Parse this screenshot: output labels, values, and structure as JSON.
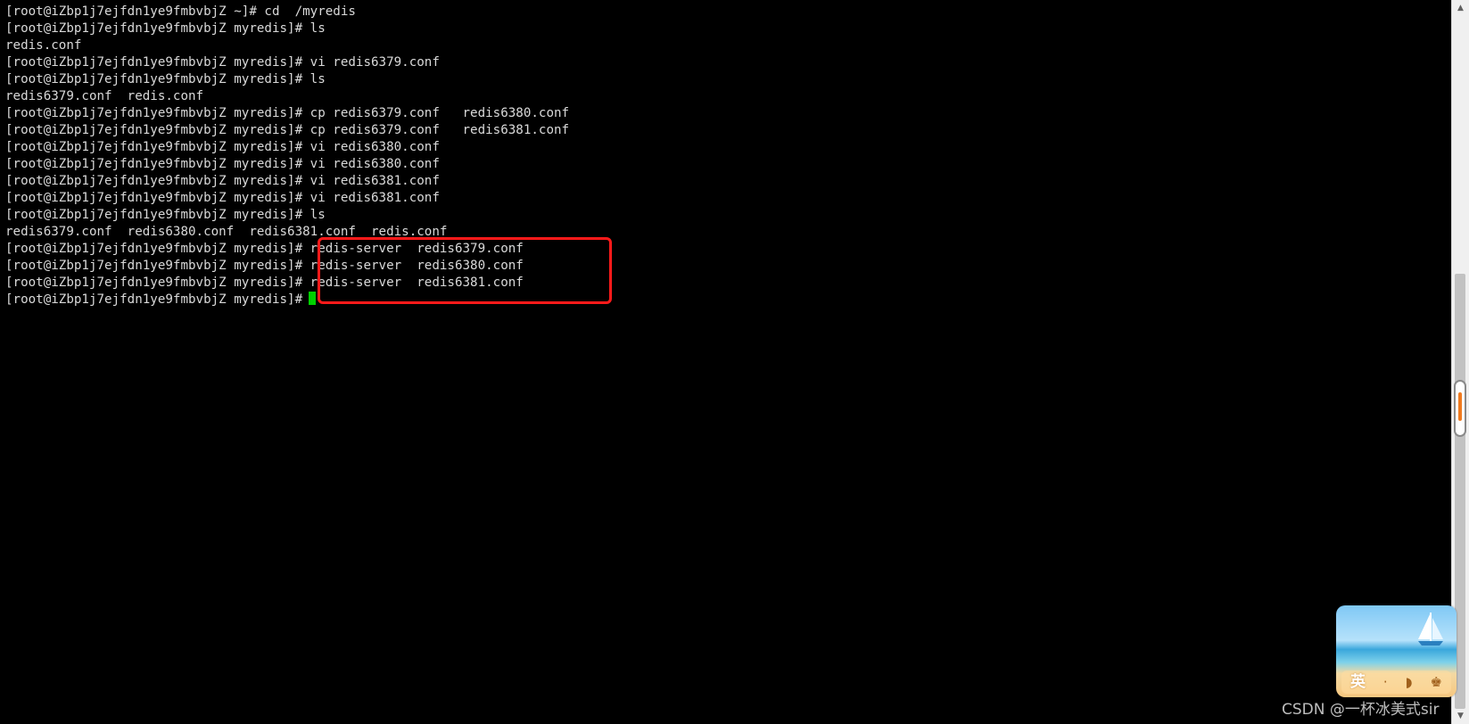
{
  "terminal": {
    "lines": [
      "[root@iZbp1j7ejfdn1ye9fmbvbjZ ~]# cd  /myredis",
      "[root@iZbp1j7ejfdn1ye9fmbvbjZ myredis]# ls",
      "redis.conf",
      "[root@iZbp1j7ejfdn1ye9fmbvbjZ myredis]# vi redis6379.conf",
      "[root@iZbp1j7ejfdn1ye9fmbvbjZ myredis]# ls",
      "redis6379.conf  redis.conf",
      "[root@iZbp1j7ejfdn1ye9fmbvbjZ myredis]# cp redis6379.conf   redis6380.conf",
      "[root@iZbp1j7ejfdn1ye9fmbvbjZ myredis]# cp redis6379.conf   redis6381.conf",
      "[root@iZbp1j7ejfdn1ye9fmbvbjZ myredis]# vi redis6380.conf",
      "[root@iZbp1j7ejfdn1ye9fmbvbjZ myredis]# vi redis6380.conf",
      "[root@iZbp1j7ejfdn1ye9fmbvbjZ myredis]# vi redis6381.conf",
      "[root@iZbp1j7ejfdn1ye9fmbvbjZ myredis]# vi redis6381.conf",
      "[root@iZbp1j7ejfdn1ye9fmbvbjZ myredis]# ls",
      "redis6379.conf  redis6380.conf  redis6381.conf  redis.conf",
      "[root@iZbp1j7ejfdn1ye9fmbvbjZ myredis]# redis-server  redis6379.conf",
      "[root@iZbp1j7ejfdn1ye9fmbvbjZ myredis]# redis-server  redis6380.conf",
      "[root@iZbp1j7ejfdn1ye9fmbvbjZ myredis]# redis-server  redis6381.conf"
    ],
    "prompt": "[root@iZbp1j7ejfdn1ye9fmbvbjZ myredis]#",
    "cursor_color": "#00d000",
    "text_color": "#d9d9d9",
    "background_color": "#000000"
  },
  "annotation": {
    "box_color": "#ff1a1a"
  },
  "scrollbar": {
    "up_icon": "triangle-up-icon",
    "down_icon": "triangle-down-icon",
    "up_glyph": "▲",
    "down_glyph": "▼"
  },
  "ime": {
    "language": "英",
    "glyphs": [
      "·",
      "◗",
      "☁",
      "♚"
    ],
    "icons": [
      "moon-icon",
      "shirt-icon",
      "sailboat-icon"
    ]
  },
  "watermark": {
    "text": "CSDN @一杯冰美式sir"
  }
}
